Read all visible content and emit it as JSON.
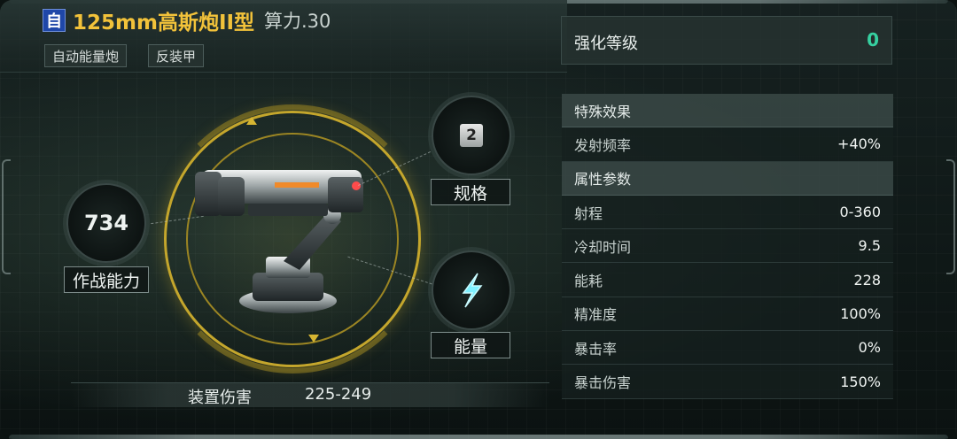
{
  "header": {
    "type_badge": "自",
    "weapon_name": "125mm高斯炮II型",
    "power_label": "算力.30",
    "tags": [
      "自动能量炮",
      "反装甲"
    ]
  },
  "enhance": {
    "label": "强化等级",
    "value": "0"
  },
  "combat": {
    "value": "734",
    "label": "作战能力"
  },
  "spec": {
    "value": "2",
    "label": "规格"
  },
  "energy": {
    "label": "能量",
    "icon": "energy-bolt-icon"
  },
  "damage": {
    "label": "装置伤害",
    "value": "225-249"
  },
  "special": {
    "title": "特殊效果",
    "items": [
      {
        "label": "发射频率",
        "value": "+40%"
      }
    ]
  },
  "attributes": {
    "title": "属性参数",
    "items": [
      {
        "label": "射程",
        "value": "0-360"
      },
      {
        "label": "冷却时间",
        "value": "9.5"
      },
      {
        "label": "能耗",
        "value": "228"
      },
      {
        "label": "精准度",
        "value": "100%"
      },
      {
        "label": "暴击率",
        "value": "0%"
      },
      {
        "label": "暴击伤害",
        "value": "150%"
      }
    ]
  },
  "colors": {
    "accent_gold": "#f2c23a",
    "accent_green": "#36d0a0",
    "badge_blue": "#1f47a8"
  }
}
